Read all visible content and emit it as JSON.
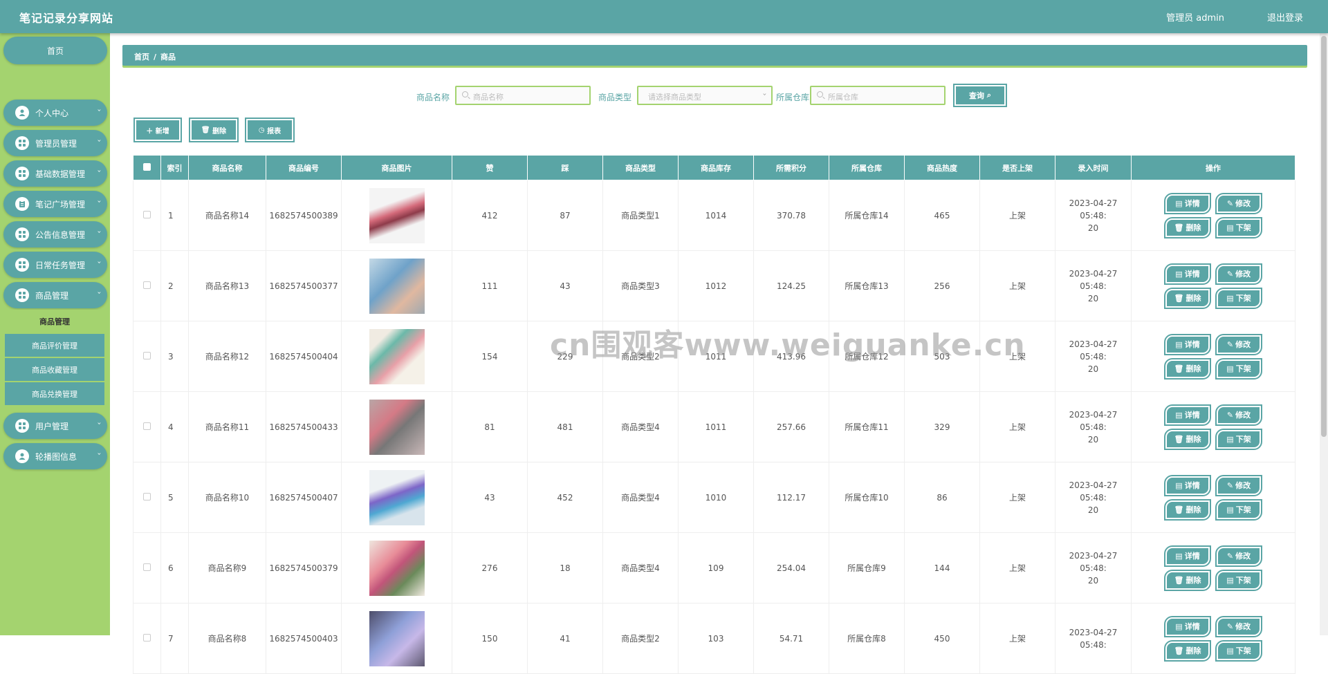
{
  "header": {
    "title": "笔记记录分享网站",
    "user": "管理员 admin",
    "logout": "退出登录"
  },
  "sidebar": {
    "home": "首页",
    "items": [
      {
        "label": "个人中心",
        "icon": "person-icon"
      },
      {
        "label": "管理员管理",
        "icon": "grid-icon"
      },
      {
        "label": "基础数据管理",
        "icon": "grid-icon"
      },
      {
        "label": "笔记广场管理",
        "icon": "clipboard-icon"
      },
      {
        "label": "公告信息管理",
        "icon": "grid-icon"
      },
      {
        "label": "日常任务管理",
        "icon": "grid-icon"
      },
      {
        "label": "商品管理",
        "icon": "grid-icon"
      },
      {
        "label": "用户管理",
        "icon": "grid-icon"
      },
      {
        "label": "轮播图信息",
        "icon": "person-icon"
      }
    ],
    "submenu": [
      "商品管理",
      "商品评价管理",
      "商品收藏管理",
      "商品兑换管理"
    ]
  },
  "breadcrumb": {
    "home": "首页",
    "sep": "/",
    "current": "商品"
  },
  "search": {
    "name_label": "商品名称",
    "name_placeholder": "商品名称",
    "type_label": "商品类型",
    "type_placeholder": "请选择商品类型",
    "warehouse_label": "所属仓库",
    "warehouse_placeholder": "所属仓库",
    "query": "查询"
  },
  "actions": {
    "add": "新增",
    "delete": "删除",
    "report": "报表"
  },
  "table": {
    "headers": [
      "索引",
      "商品名称",
      "商品编号",
      "商品图片",
      "赞",
      "踩",
      "商品类型",
      "商品库存",
      "所需积分",
      "所属仓库",
      "商品热度",
      "是否上架",
      "录入时间",
      "操作"
    ],
    "rows": [
      {
        "idx": "1",
        "name": "商品名称14",
        "code": "1682574500389",
        "like": "412",
        "dislike": "87",
        "type": "商品类型1",
        "stock": "1014",
        "points": "370.78",
        "warehouse": "所属仓库14",
        "heat": "465",
        "onsale": "上架",
        "time1": "2023-04-27 05:48:",
        "time2": "20"
      },
      {
        "idx": "2",
        "name": "商品名称13",
        "code": "1682574500377",
        "like": "111",
        "dislike": "43",
        "type": "商品类型3",
        "stock": "1012",
        "points": "124.25",
        "warehouse": "所属仓库13",
        "heat": "256",
        "onsale": "上架",
        "time1": "2023-04-27 05:48:",
        "time2": "20"
      },
      {
        "idx": "3",
        "name": "商品名称12",
        "code": "1682574500404",
        "like": "154",
        "dislike": "229",
        "type": "商品类型2",
        "stock": "1011",
        "points": "413.96",
        "warehouse": "所属仓库12",
        "heat": "503",
        "onsale": "上架",
        "time1": "2023-04-27 05:48:",
        "time2": "20"
      },
      {
        "idx": "4",
        "name": "商品名称11",
        "code": "1682574500433",
        "like": "81",
        "dislike": "481",
        "type": "商品类型4",
        "stock": "1011",
        "points": "257.66",
        "warehouse": "所属仓库11",
        "heat": "329",
        "onsale": "上架",
        "time1": "2023-04-27 05:48:",
        "time2": "20"
      },
      {
        "idx": "5",
        "name": "商品名称10",
        "code": "1682574500407",
        "like": "43",
        "dislike": "452",
        "type": "商品类型4",
        "stock": "1010",
        "points": "112.17",
        "warehouse": "所属仓库10",
        "heat": "86",
        "onsale": "上架",
        "time1": "2023-04-27 05:48:",
        "time2": "20"
      },
      {
        "idx": "6",
        "name": "商品名称9",
        "code": "1682574500379",
        "like": "276",
        "dislike": "18",
        "type": "商品类型4",
        "stock": "109",
        "points": "254.04",
        "warehouse": "所属仓库9",
        "heat": "144",
        "onsale": "上架",
        "time1": "2023-04-27 05:48:",
        "time2": "20"
      },
      {
        "idx": "7",
        "name": "商品名称8",
        "code": "1682574500403",
        "like": "150",
        "dislike": "41",
        "type": "商品类型2",
        "stock": "103",
        "points": "54.71",
        "warehouse": "所属仓库8",
        "heat": "450",
        "onsale": "上架",
        "time1": "2023-04-27 05:48:",
        "time2": ""
      }
    ],
    "ops": {
      "detail": "详情",
      "edit": "修改",
      "delete": "删除",
      "offsale": "下架"
    }
  },
  "watermark": "cn围观客www.weiguanke.cn",
  "colors": {
    "primary": "#5aa5a5",
    "accent": "#a4d36f"
  }
}
